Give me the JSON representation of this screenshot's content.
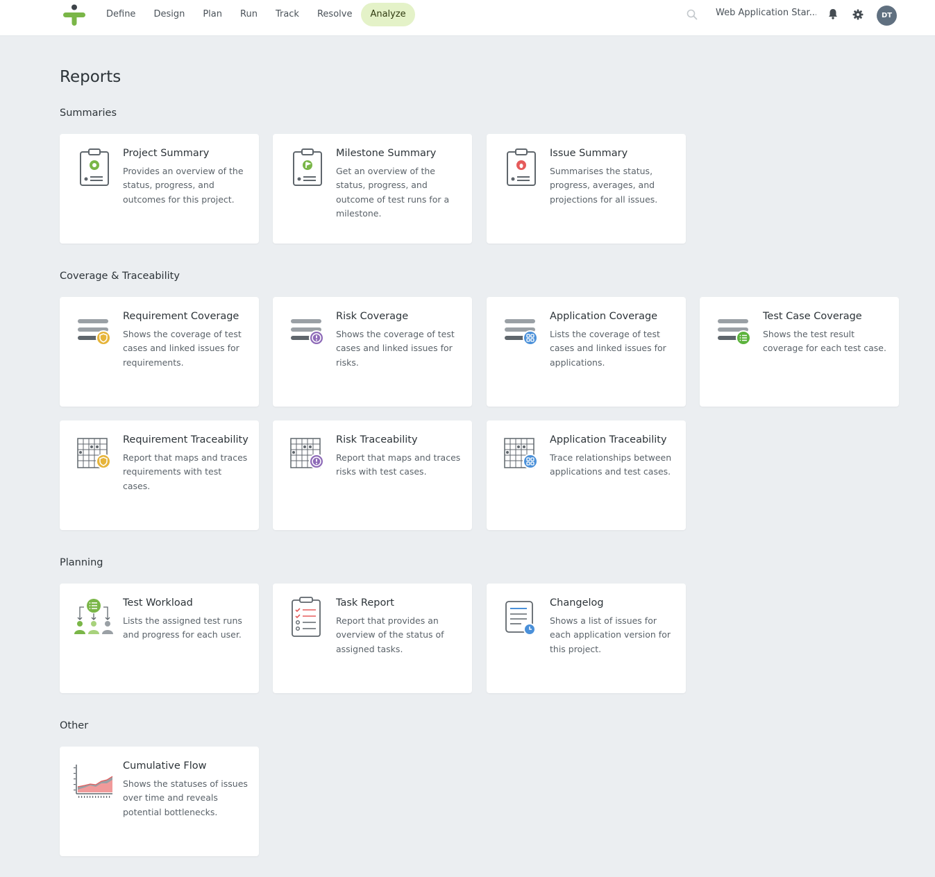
{
  "nav": {
    "items": [
      "Define",
      "Design",
      "Plan",
      "Run",
      "Track",
      "Resolve",
      "Analyze"
    ],
    "active": "Analyze"
  },
  "header": {
    "project_name": "Web Application Star...",
    "avatar_initials": "DT"
  },
  "page": {
    "title": "Reports"
  },
  "sections": [
    {
      "title": "Summaries"
    },
    {
      "title": "Coverage & Traceability"
    },
    {
      "title": "Planning"
    },
    {
      "title": "Other"
    }
  ],
  "cards": {
    "project_summary": {
      "title": "Project Summary",
      "desc": "Provides an overview of the status, progress, and outcomes for this project."
    },
    "milestone_summary": {
      "title": "Milestone Summary",
      "desc": "Get an overview of the status, progress, and outcome of test runs for a milestone."
    },
    "issue_summary": {
      "title": "Issue Summary",
      "desc": "Summarises the status, progress, averages, and projections for all issues."
    },
    "requirement_coverage": {
      "title": "Requirement Coverage",
      "desc": "Shows the coverage of test cases and linked issues for requirements."
    },
    "risk_coverage": {
      "title": "Risk Coverage",
      "desc": "Shows the coverage of test cases and linked issues for risks."
    },
    "application_coverage": {
      "title": "Application Coverage",
      "desc": "Lists the coverage of test cases and linked issues for applications."
    },
    "test_case_coverage": {
      "title": "Test Case Coverage",
      "desc": "Shows the test result coverage for each test case."
    },
    "requirement_traceability": {
      "title": "Requirement Traceability",
      "desc": "Report that maps and traces requirements with test cases."
    },
    "risk_traceability": {
      "title": "Risk Traceability",
      "desc": "Report that maps and traces risks with test cases."
    },
    "application_traceability": {
      "title": "Application Traceability",
      "desc": "Trace relationships between applications and test cases."
    },
    "test_workload": {
      "title": "Test Workload",
      "desc": "Lists the assigned test runs and progress for each user."
    },
    "task_report": {
      "title": "Task Report",
      "desc": "Report that provides an overview of the status of assigned tasks."
    },
    "changelog": {
      "title": "Changelog",
      "desc": "Shows a list of issues for each application version for this project."
    },
    "cumulative_flow": {
      "title": "Cumulative Flow",
      "desc": "Shows the statuses of issues over time and reveals potential bottlenecks."
    }
  },
  "colors": {
    "brand_green": "#7ab648",
    "active_tab_bg": "#e4f2c8",
    "requirement": "#e6b43a",
    "risk": "#8e6bb8",
    "application": "#4a90d9",
    "test_case": "#5cb33d",
    "issue": "#e55b5b"
  }
}
